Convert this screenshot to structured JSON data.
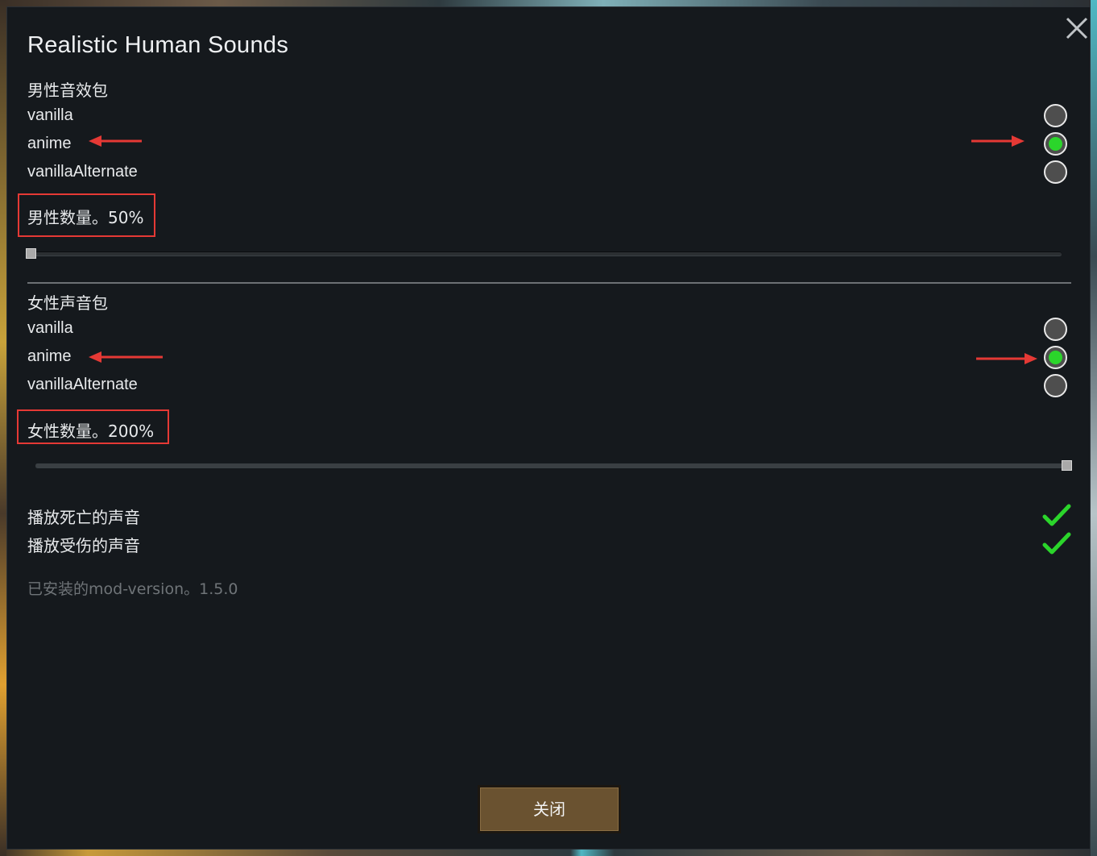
{
  "window": {
    "title": "Realistic Human Sounds",
    "close_icon": "close-icon"
  },
  "male": {
    "heading": "男性音效包",
    "options": [
      "vanilla",
      "anime",
      "vanillaAlternate"
    ],
    "selected_index": 1,
    "amount_label": "男性数量。50%",
    "slider_value": 0.0
  },
  "female": {
    "heading": "女性声音包",
    "options": [
      "vanilla",
      "anime",
      "vanillaAlternate"
    ],
    "selected_index": 1,
    "amount_label": "女性数量。200%",
    "slider_value": 1.0
  },
  "checkboxes": [
    {
      "label": "播放死亡的声音",
      "checked": true
    },
    {
      "label": "播放受伤的声音",
      "checked": true
    }
  ],
  "version_text": "已安装的mod-version。1.5.0",
  "buttons": {
    "close_label": "关闭"
  },
  "colors": {
    "background": "#15191d",
    "radio_selected": "#2bd52b",
    "check": "#2bd52b",
    "highlight": "#e53935",
    "button": "#6a5230"
  }
}
